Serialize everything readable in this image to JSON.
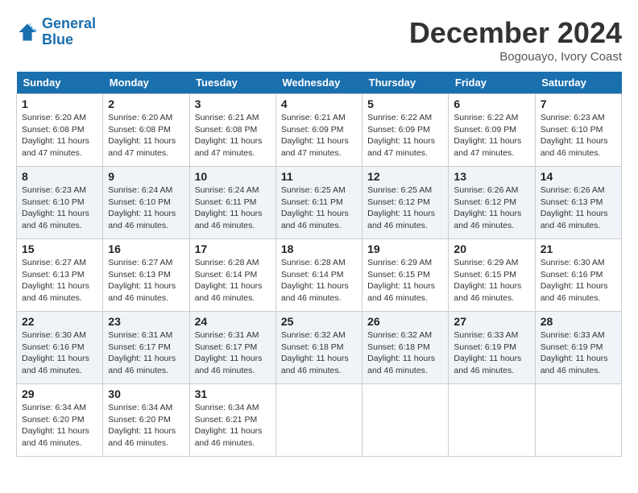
{
  "header": {
    "logo_line1": "General",
    "logo_line2": "Blue",
    "month_title": "December 2024",
    "location": "Bogouayo, Ivory Coast"
  },
  "days_of_week": [
    "Sunday",
    "Monday",
    "Tuesday",
    "Wednesday",
    "Thursday",
    "Friday",
    "Saturday"
  ],
  "weeks": [
    [
      {
        "day": "1",
        "sunrise": "6:20 AM",
        "sunset": "6:08 PM",
        "daylight": "11 hours and 47 minutes."
      },
      {
        "day": "2",
        "sunrise": "6:20 AM",
        "sunset": "6:08 PM",
        "daylight": "11 hours and 47 minutes."
      },
      {
        "day": "3",
        "sunrise": "6:21 AM",
        "sunset": "6:08 PM",
        "daylight": "11 hours and 47 minutes."
      },
      {
        "day": "4",
        "sunrise": "6:21 AM",
        "sunset": "6:09 PM",
        "daylight": "11 hours and 47 minutes."
      },
      {
        "day": "5",
        "sunrise": "6:22 AM",
        "sunset": "6:09 PM",
        "daylight": "11 hours and 47 minutes."
      },
      {
        "day": "6",
        "sunrise": "6:22 AM",
        "sunset": "6:09 PM",
        "daylight": "11 hours and 47 minutes."
      },
      {
        "day": "7",
        "sunrise": "6:23 AM",
        "sunset": "6:10 PM",
        "daylight": "11 hours and 46 minutes."
      }
    ],
    [
      {
        "day": "8",
        "sunrise": "6:23 AM",
        "sunset": "6:10 PM",
        "daylight": "11 hours and 46 minutes."
      },
      {
        "day": "9",
        "sunrise": "6:24 AM",
        "sunset": "6:10 PM",
        "daylight": "11 hours and 46 minutes."
      },
      {
        "day": "10",
        "sunrise": "6:24 AM",
        "sunset": "6:11 PM",
        "daylight": "11 hours and 46 minutes."
      },
      {
        "day": "11",
        "sunrise": "6:25 AM",
        "sunset": "6:11 PM",
        "daylight": "11 hours and 46 minutes."
      },
      {
        "day": "12",
        "sunrise": "6:25 AM",
        "sunset": "6:12 PM",
        "daylight": "11 hours and 46 minutes."
      },
      {
        "day": "13",
        "sunrise": "6:26 AM",
        "sunset": "6:12 PM",
        "daylight": "11 hours and 46 minutes."
      },
      {
        "day": "14",
        "sunrise": "6:26 AM",
        "sunset": "6:13 PM",
        "daylight": "11 hours and 46 minutes."
      }
    ],
    [
      {
        "day": "15",
        "sunrise": "6:27 AM",
        "sunset": "6:13 PM",
        "daylight": "11 hours and 46 minutes."
      },
      {
        "day": "16",
        "sunrise": "6:27 AM",
        "sunset": "6:13 PM",
        "daylight": "11 hours and 46 minutes."
      },
      {
        "day": "17",
        "sunrise": "6:28 AM",
        "sunset": "6:14 PM",
        "daylight": "11 hours and 46 minutes."
      },
      {
        "day": "18",
        "sunrise": "6:28 AM",
        "sunset": "6:14 PM",
        "daylight": "11 hours and 46 minutes."
      },
      {
        "day": "19",
        "sunrise": "6:29 AM",
        "sunset": "6:15 PM",
        "daylight": "11 hours and 46 minutes."
      },
      {
        "day": "20",
        "sunrise": "6:29 AM",
        "sunset": "6:15 PM",
        "daylight": "11 hours and 46 minutes."
      },
      {
        "day": "21",
        "sunrise": "6:30 AM",
        "sunset": "6:16 PM",
        "daylight": "11 hours and 46 minutes."
      }
    ],
    [
      {
        "day": "22",
        "sunrise": "6:30 AM",
        "sunset": "6:16 PM",
        "daylight": "11 hours and 46 minutes."
      },
      {
        "day": "23",
        "sunrise": "6:31 AM",
        "sunset": "6:17 PM",
        "daylight": "11 hours and 46 minutes."
      },
      {
        "day": "24",
        "sunrise": "6:31 AM",
        "sunset": "6:17 PM",
        "daylight": "11 hours and 46 minutes."
      },
      {
        "day": "25",
        "sunrise": "6:32 AM",
        "sunset": "6:18 PM",
        "daylight": "11 hours and 46 minutes."
      },
      {
        "day": "26",
        "sunrise": "6:32 AM",
        "sunset": "6:18 PM",
        "daylight": "11 hours and 46 minutes."
      },
      {
        "day": "27",
        "sunrise": "6:33 AM",
        "sunset": "6:19 PM",
        "daylight": "11 hours and 46 minutes."
      },
      {
        "day": "28",
        "sunrise": "6:33 AM",
        "sunset": "6:19 PM",
        "daylight": "11 hours and 46 minutes."
      }
    ],
    [
      {
        "day": "29",
        "sunrise": "6:34 AM",
        "sunset": "6:20 PM",
        "daylight": "11 hours and 46 minutes."
      },
      {
        "day": "30",
        "sunrise": "6:34 AM",
        "sunset": "6:20 PM",
        "daylight": "11 hours and 46 minutes."
      },
      {
        "day": "31",
        "sunrise": "6:34 AM",
        "sunset": "6:21 PM",
        "daylight": "11 hours and 46 minutes."
      },
      null,
      null,
      null,
      null
    ]
  ]
}
